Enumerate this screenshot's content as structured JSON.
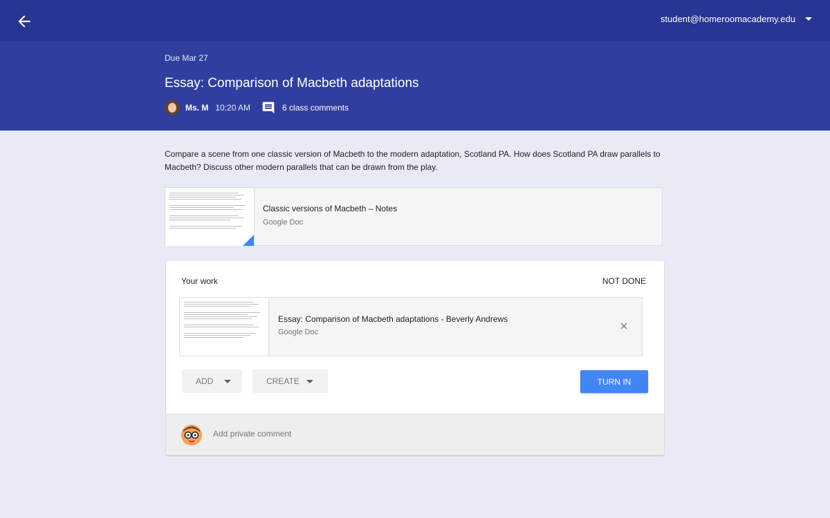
{
  "topbar": {
    "back_icon": "arrow-left-icon",
    "account_email": "student@homeroomacademy.edu",
    "account_caret_icon": "caret-down-icon"
  },
  "assignment": {
    "due": "Due Mar 27",
    "title": "Essay: Comparison of Macbeth adaptations",
    "teacher": "Ms. M",
    "posted_time": "10:20 AM",
    "comment_icon": "comment-icon",
    "class_comments": "6 class comments",
    "description": "Compare a scene from one classic version of Macbeth to the modern adaptation, Scotland PA. How does Scotland PA draw parallels to Macbeth? Discuss other modern parallels that can be drawn from the play."
  },
  "material": {
    "title": "Classic versions of Macbeth – Notes",
    "type": "Google Doc"
  },
  "your_work": {
    "label": "Your work",
    "status": "NOT DONE",
    "file": {
      "title": "Essay: Comparison of Macbeth adaptations - Beverly Andrews",
      "type": "Google Doc",
      "remove_icon": "close-icon"
    },
    "add_label": "ADD",
    "create_label": "CREATE",
    "turn_in_label": "TURN IN",
    "private_comment_placeholder": "Add private comment"
  },
  "colors": {
    "topbar": "#283593",
    "header": "#303f9f",
    "background": "#e8eaf6",
    "accent": "#4285f4"
  }
}
